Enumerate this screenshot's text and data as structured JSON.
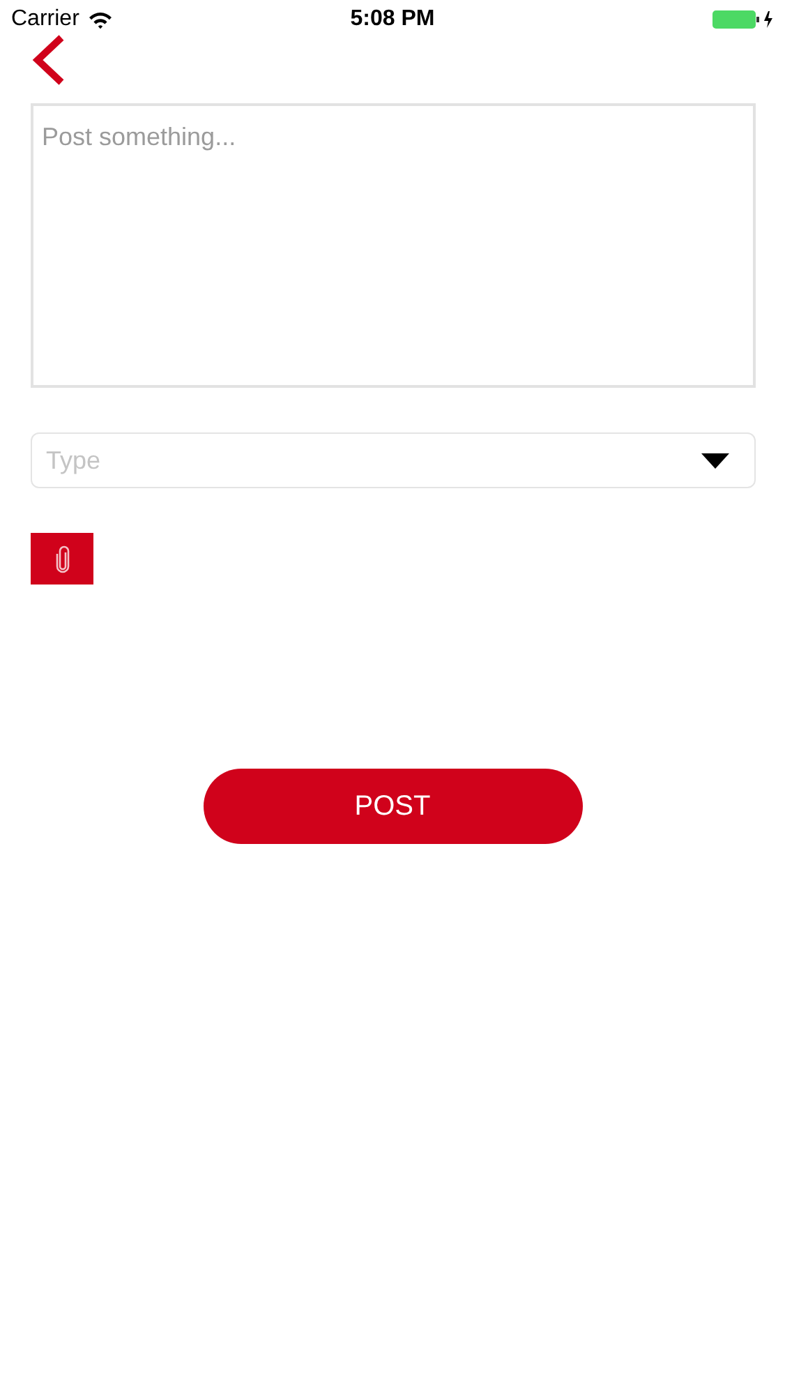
{
  "status_bar": {
    "carrier": "Carrier",
    "time": "5:08 PM"
  },
  "post_field": {
    "placeholder": "Post something..."
  },
  "type_select": {
    "placeholder": "Type"
  },
  "post_button": {
    "label": "POST"
  }
}
